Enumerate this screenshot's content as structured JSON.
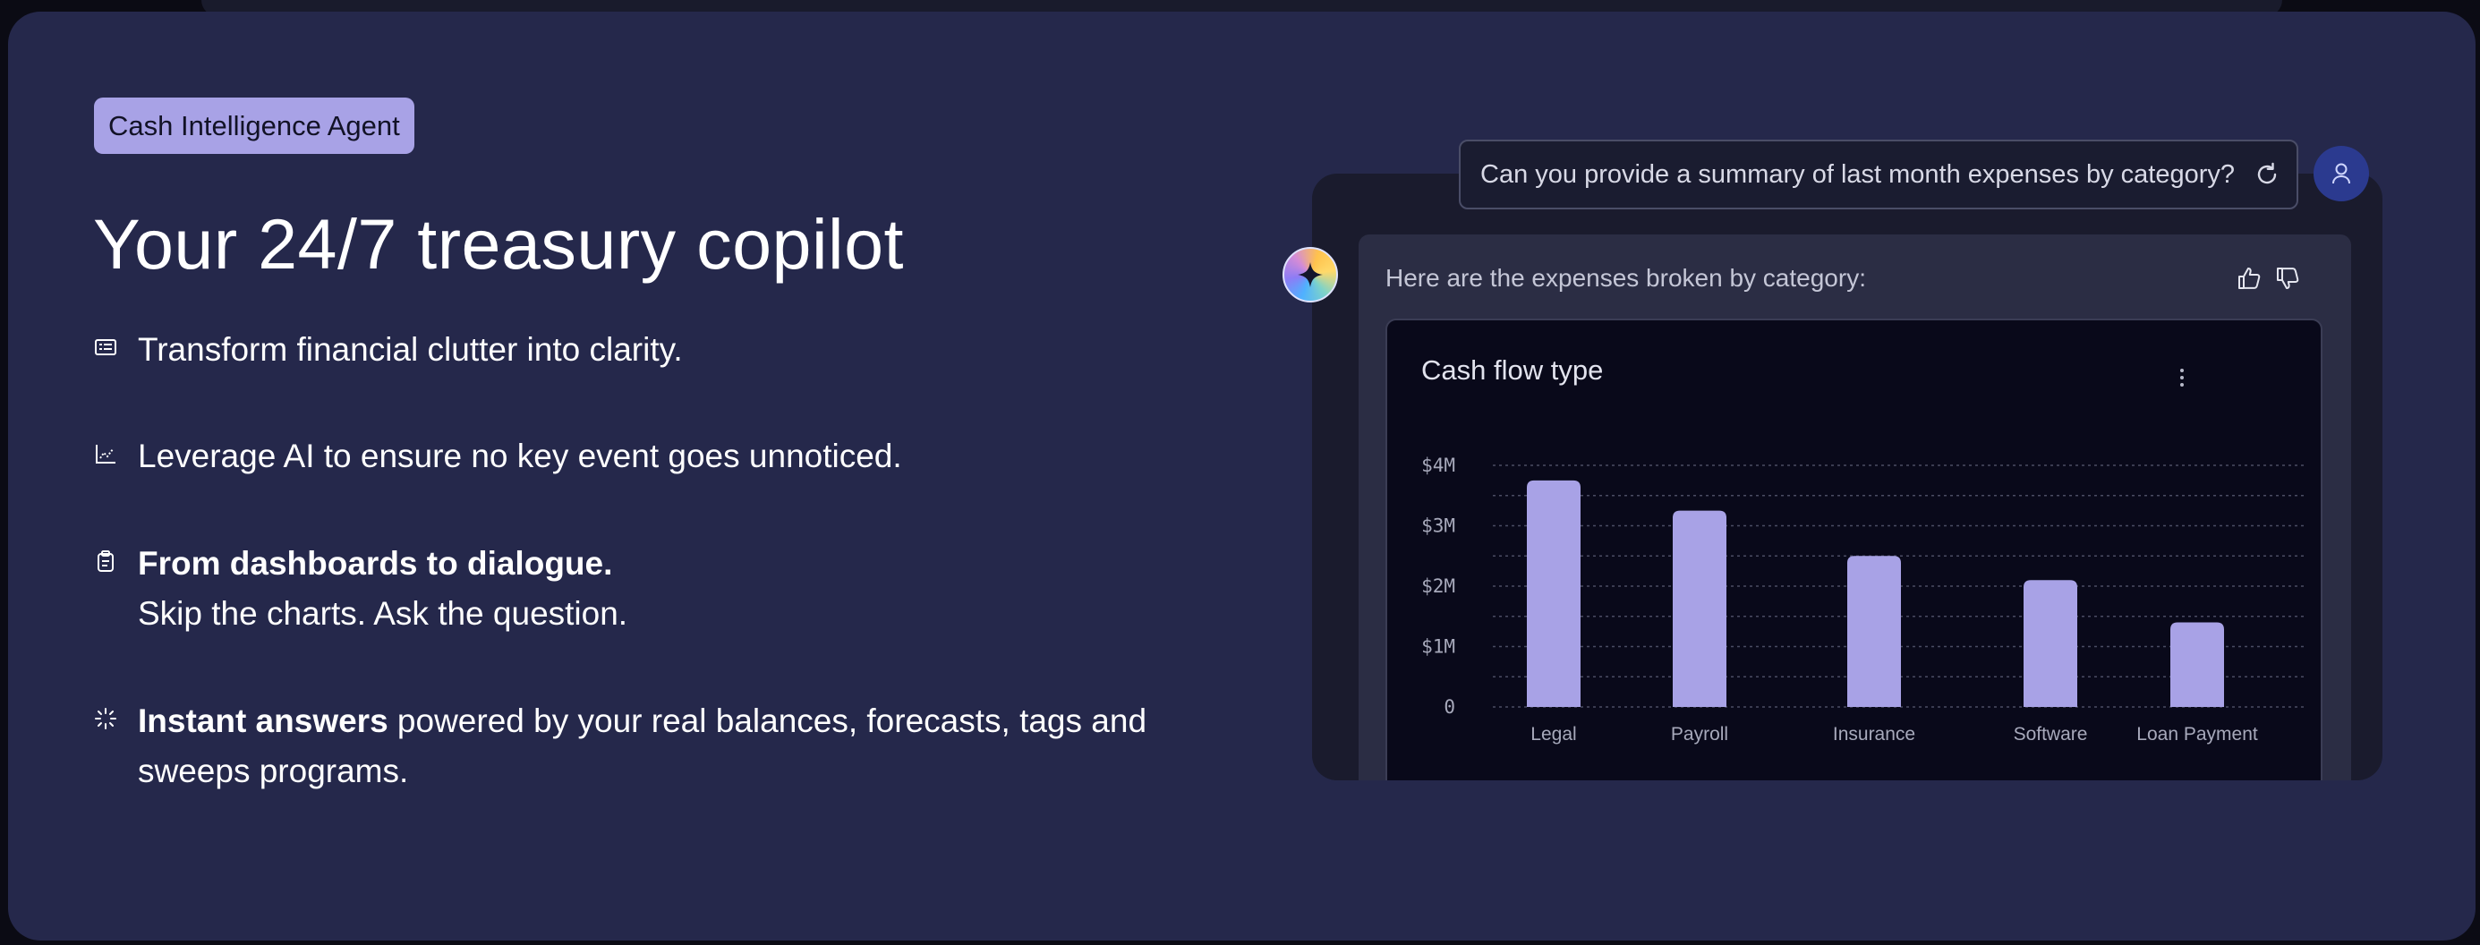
{
  "hero": {
    "badge": "Cash Intelligence Agent",
    "headline": "Your 24/7 treasury copilot",
    "features": [
      {
        "icon": "list-icon",
        "bold": "",
        "text": "Transform financial clutter into clarity."
      },
      {
        "icon": "chart-line-icon",
        "bold": "",
        "text": "Leverage AI to ensure no key event goes unnoticed."
      },
      {
        "icon": "clipboard-icon",
        "bold": "From dashboards to dialogue.",
        "text": "Skip the charts. Ask the question."
      },
      {
        "icon": "sparkle-loader-icon",
        "bold": "Instant answers",
        "text": " powered by your real balances, forecasts, tags and sweeps programs."
      }
    ]
  },
  "chat": {
    "prompt": "Can you provide a summary of last month expenses by category?",
    "response": "Here are the expenses broken by category:",
    "chart_title": "Cash flow type"
  },
  "colors": {
    "background": "#25284b",
    "accent": "#a8a2e6",
    "bar": "#a8a2e6",
    "chart_bg": "#09091a"
  },
  "chart_data": {
    "type": "bar",
    "title": "Cash flow type",
    "categories": [
      "Legal",
      "Payroll",
      "Insurance",
      "Software",
      "Loan Payment"
    ],
    "values": [
      3.75,
      3.25,
      2.5,
      2.1,
      1.4
    ],
    "unit": "$M",
    "yticks": [
      "0",
      "$1M",
      "$2M",
      "$3M",
      "$4M"
    ],
    "ylim": [
      0,
      4
    ],
    "grid": true,
    "xlabel": "",
    "ylabel": ""
  }
}
